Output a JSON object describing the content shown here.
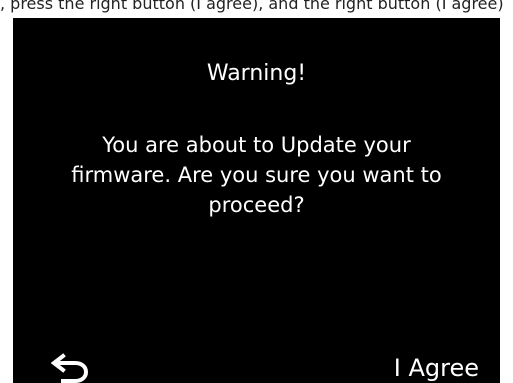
{
  "top_strip": {
    "text": ", press the right button (I agree), and the right button (I agree)"
  },
  "dialog": {
    "title": "Warning!",
    "message": "You are about to Update your firmware. Are you sure you want to proceed?"
  },
  "controls": {
    "back_icon": "back-arrow-icon",
    "agree_label": "I Agree"
  },
  "colors": {
    "screen_background": "#000000",
    "text": "#ffffff",
    "page_background": "#ffffff"
  }
}
